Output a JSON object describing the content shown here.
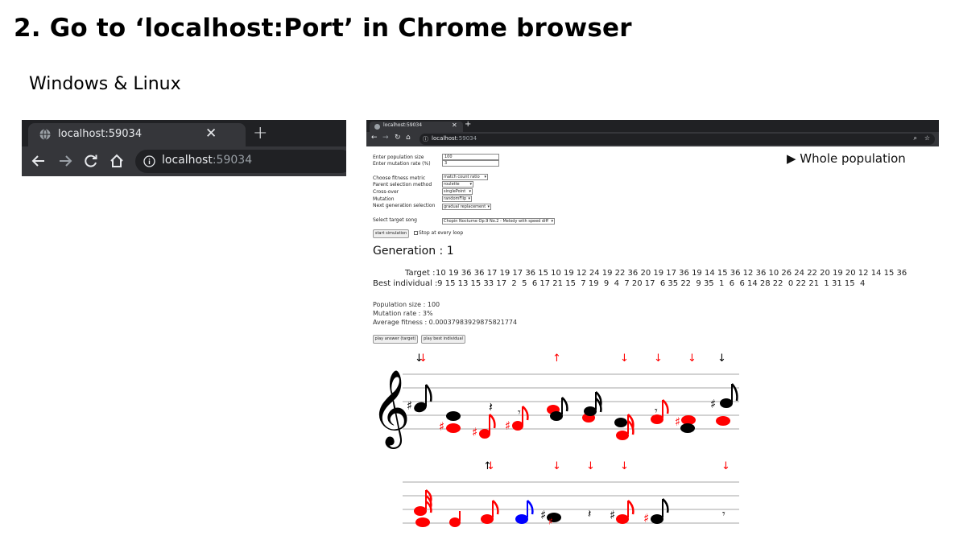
{
  "slide": {
    "title": "2. Go to ‘localhost:Port’ in Chrome browser",
    "subtitle": "Windows & Linux"
  },
  "browser_crop": {
    "tab_title": "localhost:59034",
    "url_host": "localhost",
    "url_port": ":59034",
    "icons": [
      "globe-icon",
      "close-icon",
      "new-tab-icon",
      "back-icon",
      "forward-icon",
      "reload-icon",
      "home-icon",
      "info-icon"
    ]
  },
  "screenshot": {
    "tab_title": "localhost:59034",
    "url_host": "localhost",
    "url_port": ":59034",
    "form": {
      "population_label": "Enter population size",
      "population_value": "100",
      "mutation_label": "Enter mutation rate (%)",
      "mutation_value": "3",
      "fitness_label": "Choose fitness metric",
      "fitness_value": "match count ratio",
      "parent_label": "Parent selection method",
      "parent_value": "roulette",
      "crossover_label": "Cross-over",
      "crossover_value": "singlePoint",
      "mutation_method_label": "Mutation",
      "mutation_method_value": "randomFlip",
      "nextgen_label": "Next generation selection",
      "nextgen_value": "gradual replacement",
      "song_label": "Select target song",
      "song_value": "Chopin Nocturne Op.9 No.2 - Melody with speed diff",
      "start_button": "start simulation",
      "stop_label": "Stop at every loop"
    },
    "whole_population": "▶ Whole population",
    "generation": "Generation : 1",
    "target_label": "Target :",
    "target_values": "10 19 36 36 17 19 17 36 15 10 19 12 24 19 22 36 20 19 17 36 19 14 15 36 12 36 10 26 24 22 20 19 20 12 14 15 36",
    "best_label": "Best individual :",
    "best_values": " 9 15 13 15 33 17  2  5  6 17 21 15  7 19  9  4  7 20 17  6 35 22  9 35  1  6  6 14 28 22  0 22 21  1 31 15  4",
    "population_size": "Population size : 100",
    "mutation_rate": "Mutation rate : 3%",
    "average_fitness": "Average fitness : 0.00037983929875821774",
    "play_target_button": "play answer (target)",
    "play_best_button": "play best individual"
  },
  "colors": {
    "chrome_dark": "#202124",
    "chrome_tab": "#35363a",
    "chrome_text": "#e8eaed",
    "note_red": "#ff0000",
    "note_black": "#000000",
    "note_blue": "#0000ff"
  }
}
